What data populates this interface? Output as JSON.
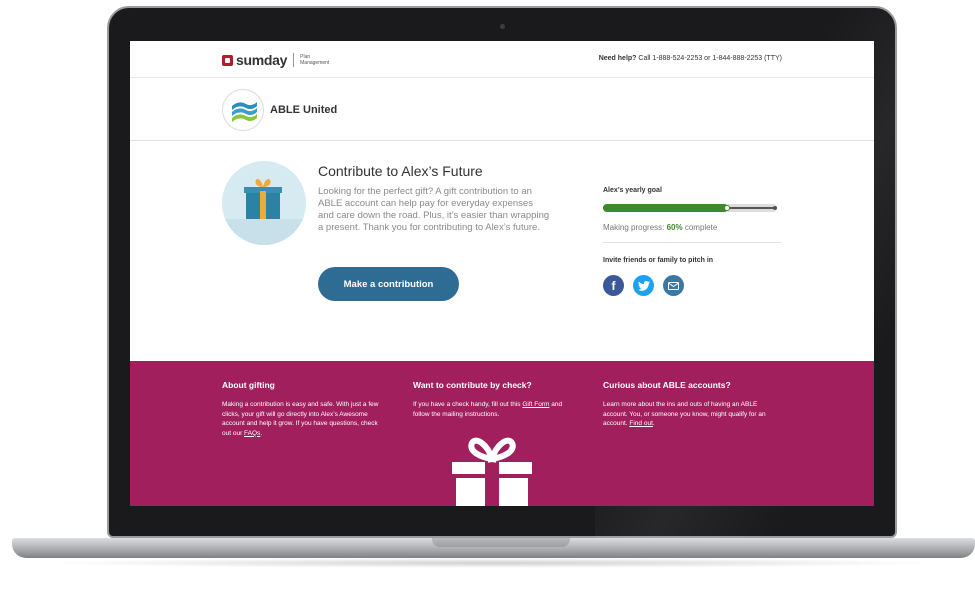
{
  "header": {
    "brand": "sumday",
    "brand_sub": "Plan Management",
    "help_label": "Need help?",
    "help_text": "Call 1-888-524-2253 or 1-844-888-2253 (TTY)"
  },
  "org": {
    "name": "ABLE United"
  },
  "campaign": {
    "title": "Contribute to Alex’s Future",
    "description": "Looking for the perfect gift? A gift contribution to an ABLE account can help pay for everyday expenses and care down the road. Plus, it’s easier than wrapping a present. Thank you for contributing to Alex’s future.",
    "cta_label": "Make a contribution"
  },
  "goal": {
    "label": "Alex’s yearly goal",
    "progress_prefix": "Making progress: ",
    "progress_pct_text": "60%",
    "progress_suffix": " complete",
    "progress_fraction": 0.6,
    "invite_label": "Invite friends or family to pitch in",
    "share_icons": [
      "facebook-icon",
      "twitter-icon",
      "email-icon"
    ]
  },
  "footer": {
    "col1": {
      "title": "About gifting",
      "text": "Making a contribution is easy and safe. With just a few clicks, your gift will go directly into Alex’s Awesome account and help it grow. If you have questions, check out our ",
      "link": "FAQs",
      "text_end": "."
    },
    "col2": {
      "title": "Want to contribute by check?",
      "text": "If you have a check handy, fill out this ",
      "link": "Gift Form",
      "text_end": " and follow the mailing instructions."
    },
    "col3": {
      "title": "Curious about ABLE accounts?",
      "text": "Learn more about the ins and outs of having an ABLE account. You, or someone you know, might qualify for an account. ",
      "link": "Find out",
      "text_end": "."
    }
  },
  "colors": {
    "brand_red": "#b01d2a",
    "cta_blue": "#2e6c93",
    "progress_green": "#3d8a2c",
    "footer_magenta": "#a01f5c"
  }
}
